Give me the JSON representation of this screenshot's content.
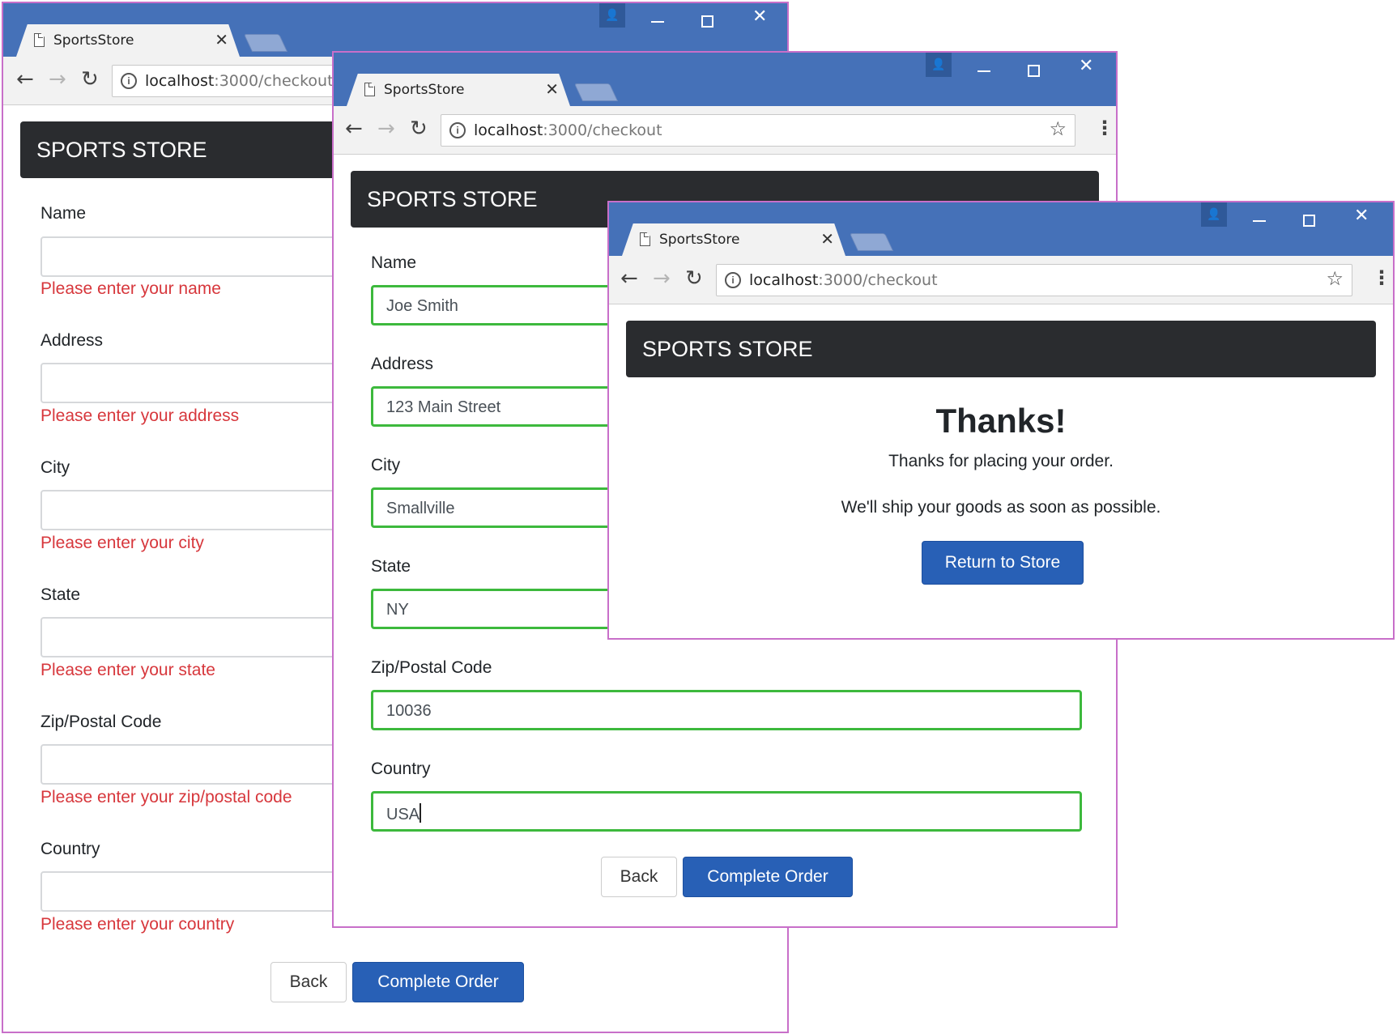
{
  "browser": {
    "tab_title": "SportsStore",
    "tab_close": "✕",
    "profile_glyph": "👤",
    "url_host": "localhost",
    "url_path": ":3000/checkout",
    "info_glyph": "i",
    "back_glyph": "←",
    "forward_glyph": "→",
    "reload_glyph": "↻",
    "star_glyph": "☆",
    "menu_glyph": "⋮",
    "close_glyph": "✕"
  },
  "store": {
    "brand": "SPORTS STORE"
  },
  "checkout_empty": {
    "fields": [
      {
        "label": "Name",
        "value": "",
        "error": "Please enter your name"
      },
      {
        "label": "Address",
        "value": "",
        "error": "Please enter your address"
      },
      {
        "label": "City",
        "value": "",
        "error": "Please enter your city"
      },
      {
        "label": "State",
        "value": "",
        "error": "Please enter your state"
      },
      {
        "label": "Zip/Postal Code",
        "value": "",
        "error": "Please enter your zip/postal code"
      },
      {
        "label": "Country",
        "value": "",
        "error": "Please enter your country"
      }
    ],
    "back_label": "Back",
    "complete_label": "Complete Order"
  },
  "checkout_filled": {
    "fields": [
      {
        "label": "Name",
        "value": "Joe Smith"
      },
      {
        "label": "Address",
        "value": "123 Main Street"
      },
      {
        "label": "City",
        "value": "Smallville"
      },
      {
        "label": "State",
        "value": "NY"
      },
      {
        "label": "Zip/Postal Code",
        "value": "10036"
      },
      {
        "label": "Country",
        "value": "USA"
      }
    ],
    "back_label": "Back",
    "complete_label": "Complete Order"
  },
  "thanks": {
    "title": "Thanks!",
    "line1": "Thanks for placing your order.",
    "line2": "We'll ship your goods as soon as possible.",
    "return_label": "Return to Store"
  },
  "colors": {
    "titlebar": "#4571b8",
    "window_border": "#c86fc9",
    "brand_bar": "#2a2c2f",
    "error_text": "#d7373c",
    "valid_border": "#3db93d",
    "primary_button": "#2860b6"
  }
}
